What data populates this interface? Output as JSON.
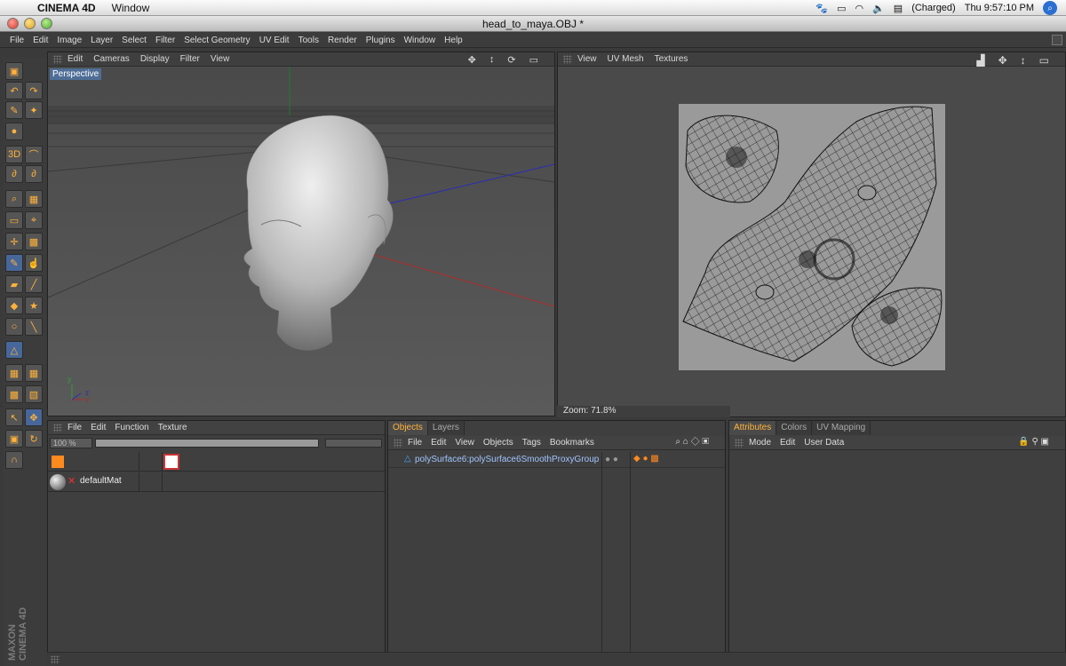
{
  "os_menubar": {
    "app_name": "CINEMA 4D",
    "menu": "Window",
    "battery": "(Charged)",
    "clock": "Thu 9:57:10 PM"
  },
  "window": {
    "title": "head_to_maya.OBJ *"
  },
  "app_menu": [
    "File",
    "Edit",
    "Image",
    "Layer",
    "Select",
    "Filter",
    "Select Geometry",
    "UV Edit",
    "Tools",
    "Render",
    "Plugins",
    "Window",
    "Help"
  ],
  "viewport": {
    "menu": [
      "Edit",
      "Cameras",
      "Display",
      "Filter",
      "View"
    ],
    "label": "Perspective",
    "axis_letters": [
      "y",
      "z",
      "x"
    ]
  },
  "uv_window": {
    "menu": [
      "View",
      "UV Mesh",
      "Textures"
    ],
    "zoom": "Zoom: 71.8%"
  },
  "material_manager": {
    "menu": [
      "File",
      "Edit",
      "Function",
      "Texture"
    ],
    "zoom_value": "100 %",
    "material_name": "defaultMat"
  },
  "objects_manager": {
    "tabs": [
      "Objects",
      "Layers"
    ],
    "menu": [
      "File",
      "Edit",
      "View",
      "Objects",
      "Tags",
      "Bookmarks"
    ],
    "object_name": "polySurface6:polySurface6SmoothProxyGroup"
  },
  "attributes_manager": {
    "tabs": [
      "Attributes",
      "Colors",
      "UV Mapping"
    ],
    "menu": [
      "Mode",
      "Edit",
      "User Data"
    ]
  },
  "brand": "MAXON CINEMA 4D",
  "colors": {
    "accent_orange": "#ffb43a",
    "selection_blue": "#4f6e96",
    "panel_bg": "#3f3f3f"
  }
}
